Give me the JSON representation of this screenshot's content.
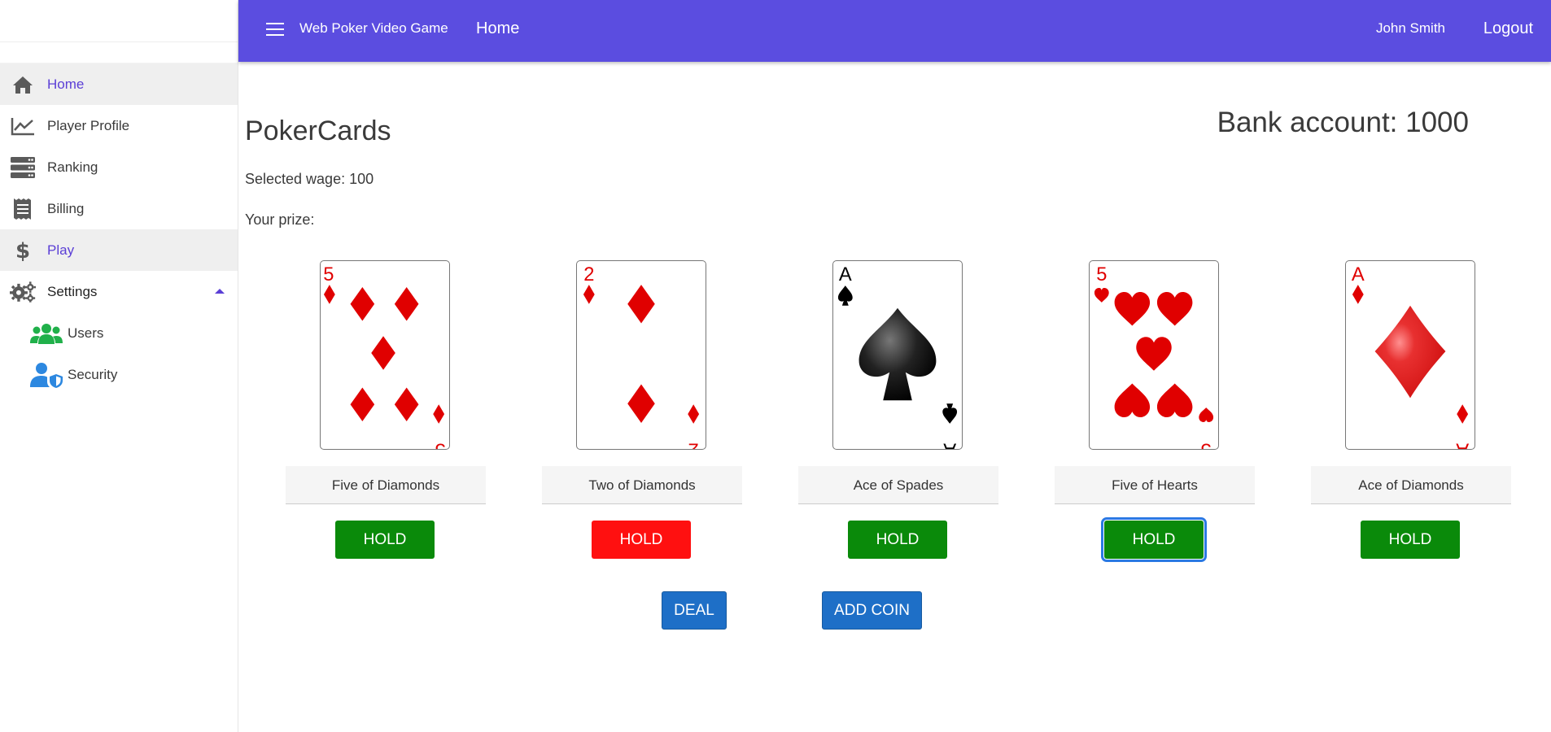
{
  "topbar": {
    "app_title": "Web Poker Video Game",
    "home_link": "Home",
    "user_name": "John Smith",
    "logout": "Logout",
    "color": "#5b4de0"
  },
  "sidebar": {
    "items": [
      {
        "label": "Home",
        "icon": "home-icon",
        "active": true
      },
      {
        "label": "Player Profile",
        "icon": "chart-icon"
      },
      {
        "label": "Ranking",
        "icon": "server-icon"
      },
      {
        "label": "Billing",
        "icon": "receipt-icon"
      },
      {
        "label": "Play",
        "icon": "dollar-icon",
        "active": true
      },
      {
        "label": "Settings",
        "icon": "gears-icon",
        "expanded": true
      },
      {
        "label": "Users",
        "icon": "users-icon",
        "sub": true
      },
      {
        "label": "Security",
        "icon": "user-shield-icon",
        "sub": true
      }
    ]
  },
  "main": {
    "title": "PokerCards",
    "bank_account": "Bank account: 1000",
    "selected_wage": "Selected wage: 100",
    "prize": "Your prize:",
    "cards": [
      {
        "name": "Five of Diamonds",
        "rank": "5",
        "suit": "diamond",
        "hold_label": "HOLD",
        "hold_color": "green"
      },
      {
        "name": "Two of Diamonds",
        "rank": "2",
        "suit": "diamond",
        "hold_label": "HOLD",
        "hold_color": "red"
      },
      {
        "name": "Ace of Spades",
        "rank": "A",
        "suit": "spade",
        "hold_label": "HOLD",
        "hold_color": "green"
      },
      {
        "name": "Five of Hearts",
        "rank": "5",
        "suit": "heart",
        "hold_label": "HOLD",
        "hold_color": "green",
        "focused": true
      },
      {
        "name": "Ace of Diamonds",
        "rank": "A",
        "suit": "diamond",
        "hold_label": "HOLD",
        "hold_color": "green"
      }
    ],
    "deal_label": "DEAL",
    "add_coin_label": "ADD COIN"
  }
}
